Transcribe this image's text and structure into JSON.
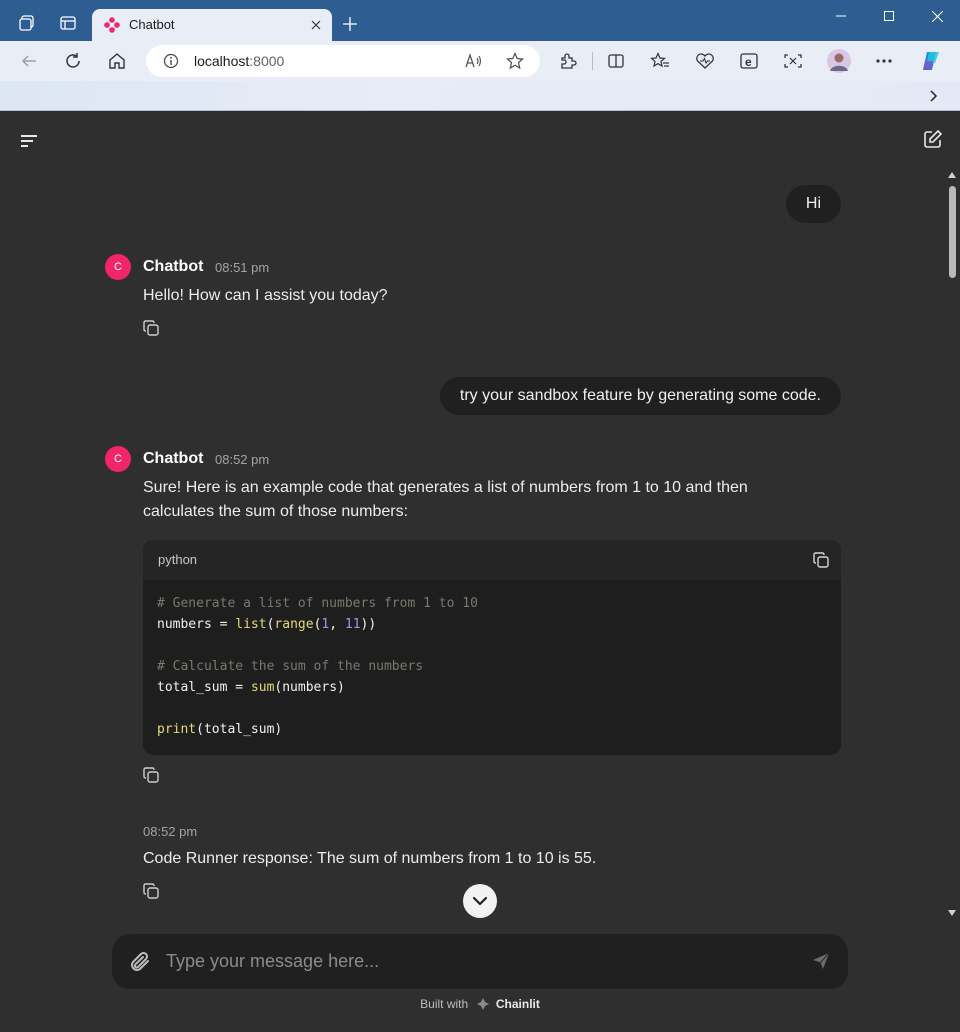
{
  "browser": {
    "tab_title": "Chatbot",
    "address": {
      "host": "localhost",
      "port": ":8000"
    },
    "accent": "#2d5d91"
  },
  "chat": {
    "messages": {
      "user1": "Hi",
      "bot1": {
        "avatar": "C",
        "name": "Chatbot",
        "time": "08:51 pm",
        "text": "Hello! How can I assist you today?"
      },
      "user2": "try your sandbox feature by generating some code.",
      "bot2": {
        "avatar": "C",
        "name": "Chatbot",
        "time": "08:52 pm",
        "text_line1": "Sure! Here is an example code that generates a list of numbers from 1 to 10 and then",
        "text_line2": "calculates the sum of those numbers:",
        "code": {
          "language": "python",
          "line1": "# Generate a list of numbers from 1 to 10",
          "line2": {
            "var": "numbers = ",
            "fn1": "list",
            "fn2": "range",
            "n1": "1",
            "n2": "11"
          },
          "line4": "# Calculate the sum of the numbers",
          "line5": {
            "var": "total_sum = ",
            "fn": "sum",
            "arg": "numbers"
          },
          "line7": {
            "fn": "print",
            "arg": "total_sum"
          }
        }
      },
      "runner": {
        "time": "08:52 pm",
        "text": "Code Runner response: The sum of numbers from 1 to 10 is 55."
      }
    }
  },
  "composer": {
    "placeholder": "Type your message here..."
  },
  "footer": {
    "prefix": "Built with",
    "brand": "Chainlit"
  },
  "colors": {
    "avatar": "#f0256a",
    "code_bg": "#1e1e1e",
    "comment": "#777a6c",
    "function": "#e5d87a",
    "number": "#b78cf2"
  }
}
